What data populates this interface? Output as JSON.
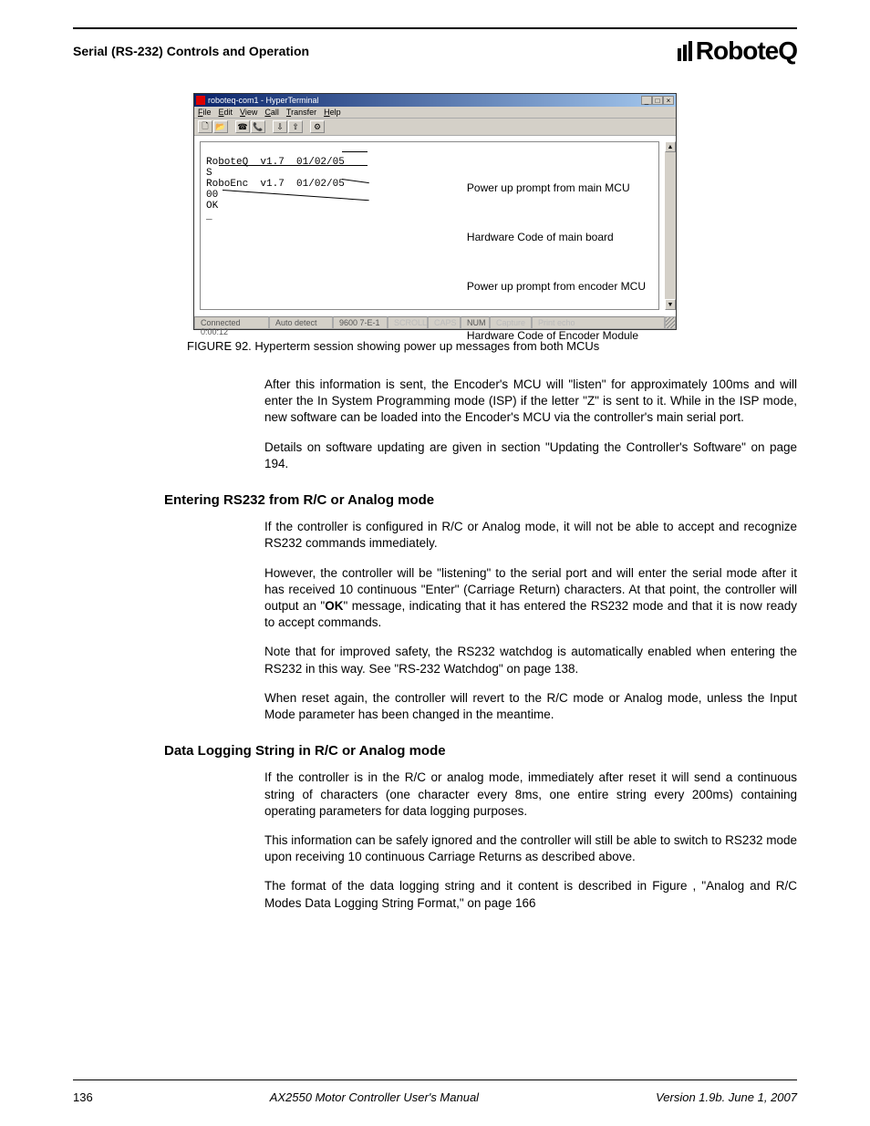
{
  "header": {
    "section_title": "Serial (RS-232) Controls and Operation",
    "logo_text": "RoboteQ"
  },
  "hyperterm": {
    "title": "roboteq-com1 - HyperTerminal",
    "menu": [
      "File",
      "Edit",
      "View",
      "Call",
      "Transfer",
      "Help"
    ],
    "terminal_lines": {
      "l1": "RoboteQ  v1.7  01/02/05",
      "l2": "S",
      "l3": "RoboEnc  v1.7  01/02/05",
      "l4": "00",
      "l5": "OK",
      "l6": "_"
    },
    "annotations": {
      "a1": "Power up prompt from main MCU",
      "a2": "Hardware Code of main board",
      "a3": "Power up prompt from encoder MCU",
      "a4": "Hardware Code of Encoder Module"
    },
    "status": {
      "connected": "Connected 0:00:12",
      "detect": "Auto detect",
      "baud": "9600 7-E-1",
      "scroll": "SCROLL",
      "caps": "CAPS",
      "num": "NUM",
      "capture": "Capture",
      "echo": "Print echo"
    }
  },
  "figure_caption": "FIGURE 92.  Hyperterm session showing power up messages from both MCUs",
  "para1": "After this information is sent, the Encoder's MCU will \"listen\" for approximately 100ms and will enter the In System Programming mode (ISP) if the letter \"Z\" is sent to it. While in the ISP mode, new software can be loaded into the Encoder's MCU via the controller's main serial port.",
  "para2": "Details on software updating are given in section \"Updating the Controller's Software\" on page 194.",
  "h2a": "Entering RS232 from R/C or Analog mode",
  "para3": "If the controller is configured in R/C or Analog mode, it will not be able to accept and recognize RS232 commands immediately.",
  "para4_pre": "However, the controller will be \"listening\" to the serial port and will enter the serial mode after it has received 10 continuous \"Enter\" (Carriage Return) characters. At that point, the controller will output an \"",
  "para4_bold": "OK",
  "para4_post": "\" message, indicating that it has entered the RS232 mode and that it is now ready to accept commands.",
  "para5": "Note that for improved safety, the RS232 watchdog is automatically enabled when entering the RS232 in this way. See \"RS-232 Watchdog\" on page 138.",
  "para6": "When reset again, the controller will revert to the R/C mode or Analog mode, unless the Input Mode parameter has been changed in the meantime.",
  "h2b": "Data Logging String in R/C or Analog mode",
  "para7": "If the controller is in the R/C or analog mode, immediately after reset it will send a continuous string of characters (one character every 8ms, one entire string every 200ms) containing operating parameters for data logging purposes.",
  "para8": "This information can be safely ignored and the controller will still be able to switch to RS232 mode upon receiving 10 continuous Carriage Returns as described above.",
  "para9": "The format of the data logging string and it content is described in Figure , \"Analog and R/C Modes Data Logging String Format,\" on page 166",
  "footer": {
    "page": "136",
    "center": "AX2550 Motor Controller User's Manual",
    "right": "Version 1.9b. June 1, 2007"
  }
}
